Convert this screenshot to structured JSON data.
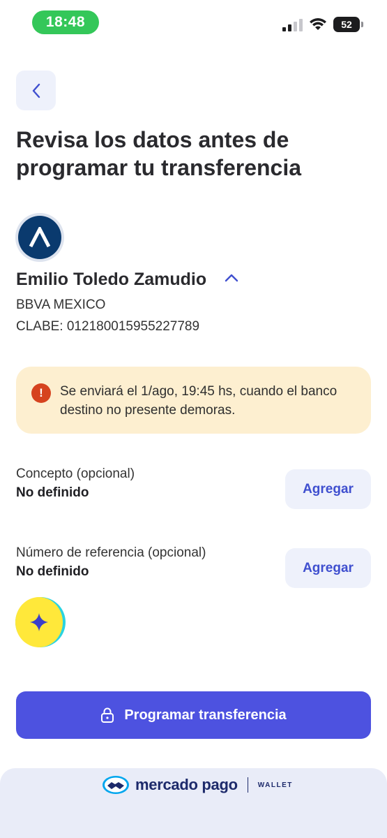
{
  "status_bar": {
    "time": "18:48",
    "battery": "52"
  },
  "header": {
    "title": "Revisa los datos antes de programar tu transferencia"
  },
  "recipient": {
    "name": "Emilio Toledo Zamudio",
    "bank": "BBVA MEXICO",
    "clabe": "CLABE: 012180015955227789"
  },
  "notice": {
    "text": "Se enviará el 1/ago, 19:45 hs, cuando el banco destino no presente demoras."
  },
  "fields": [
    {
      "label": "Concepto (opcional)",
      "value": "No definido",
      "button": "Agregar"
    },
    {
      "label": "Número de referencia (opcional)",
      "value": "No definido",
      "button": "Agregar"
    }
  ],
  "primary_button": {
    "label": "Programar transferencia"
  },
  "footer": {
    "brand": "mercado pago",
    "sub": "WALLET"
  },
  "colors": {
    "accent": "#4d52e0",
    "notice_bg": "#fdefd0",
    "warning": "#d6431f",
    "bank": "#0a3a6e"
  }
}
